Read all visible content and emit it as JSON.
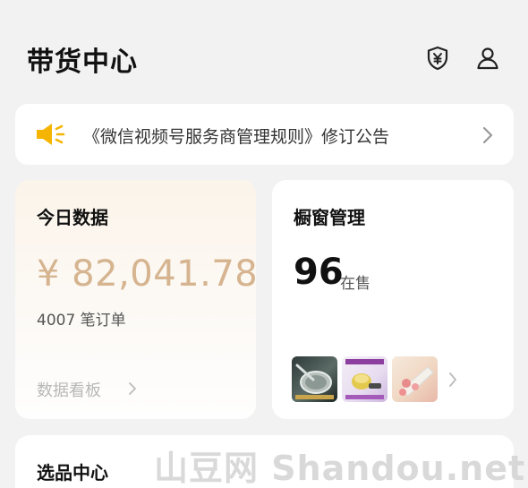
{
  "header": {
    "title": "带货中心",
    "icons": [
      "yuan-shield-icon",
      "user-icon"
    ]
  },
  "notice": {
    "icon": "speaker-icon",
    "text": "《微信视频号服务商管理规则》修订公告",
    "accent_color": "#f5b400"
  },
  "today_data": {
    "title": "今日数据",
    "amount": "¥ 82,041.78",
    "orders": "4007 笔订单",
    "dashboard_link": "数据看板",
    "amount_color": "#d5b48f"
  },
  "window": {
    "title": "橱窗管理",
    "count": "96",
    "count_label": "在售",
    "thumbnails": [
      "product-thumbnail",
      "product-thumbnail",
      "product-thumbnail"
    ]
  },
  "selection": {
    "title": "选品中心"
  },
  "watermark": {
    "text": "山豆网 Shandou.net"
  }
}
